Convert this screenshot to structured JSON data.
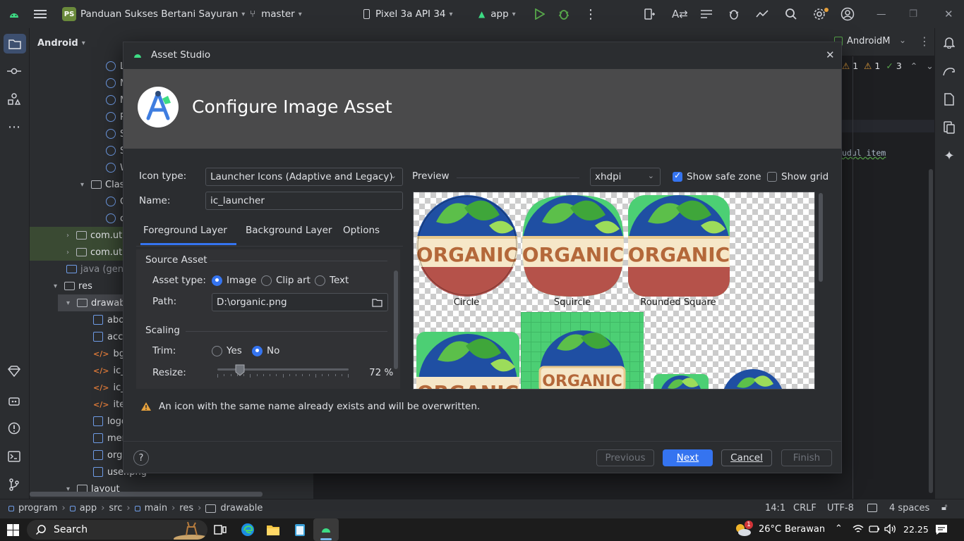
{
  "titlebar": {
    "project_badge": "PS",
    "project_name": "Panduan Sukses Bertani Sayuran",
    "branch": "master",
    "device": "Pixel 3a API 34",
    "run_config": "app"
  },
  "project_panel": {
    "view_selector": "Android",
    "rows": [
      "L",
      "M",
      "M",
      "P",
      "S",
      "S",
      "W",
      "Clas",
      "C",
      "c",
      "com.ut",
      "com.ut",
      "java (gene",
      "res",
      "drawab",
      "abo",
      "acc",
      "bg.x",
      "ic_la",
      "ic_la",
      "item",
      "logo",
      "mer",
      "orga",
      "user.png",
      "layout"
    ]
  },
  "editor": {
    "tabs_visible": [
      "AndroidM"
    ],
    "inspection": {
      "warnings": "1",
      "weak_warnings": "1",
      "typos": "3"
    },
    "code_fragment": "udul item"
  },
  "dialog": {
    "window_title": "Asset Studio",
    "header": "Configure Image Asset",
    "icon_type_label": "Icon type:",
    "icon_type_value": "Launcher Icons (Adaptive and Legacy)",
    "name_label": "Name:",
    "name_value": "ic_launcher",
    "tabs": [
      "Foreground Layer",
      "Background Layer",
      "Options"
    ],
    "active_tab": "Foreground Layer",
    "source_asset_heading": "Source Asset",
    "asset_type_label": "Asset type:",
    "asset_types": [
      "Image",
      "Clip art",
      "Text"
    ],
    "asset_type_selected": "Image",
    "path_label": "Path:",
    "path_value": "D:\\organic.png",
    "scaling_heading": "Scaling",
    "trim_label": "Trim:",
    "trim_options": [
      "Yes",
      "No"
    ],
    "trim_selected": "No",
    "resize_label": "Resize:",
    "resize_value": "72 %",
    "resize_level": 0.17,
    "preview_label": "Preview",
    "density": "xhdpi",
    "show_safe_zone_label": "Show safe zone",
    "show_safe_zone": true,
    "show_grid_label": "Show grid",
    "show_grid": false,
    "preview_captions": [
      "Circle",
      "Squircle",
      "Rounded Square"
    ],
    "icon_text": "ORGANIC",
    "warning": "An icon with the same name already exists and will be overwritten.",
    "buttons": {
      "help": "?",
      "previous": "Previous",
      "next": "Next",
      "cancel": "Cancel",
      "finish": "Finish"
    }
  },
  "statusbar": {
    "breadcrumb": [
      "program",
      "app",
      "src",
      "main",
      "res",
      "drawable"
    ],
    "position": "14:1",
    "line_ending": "CRLF",
    "encoding": "UTF-8",
    "indent": "4 spaces"
  },
  "taskbar": {
    "search_label": "Search",
    "notification_count": "1",
    "temperature": "26°C",
    "weather": "Berawan",
    "time": "22.25"
  }
}
